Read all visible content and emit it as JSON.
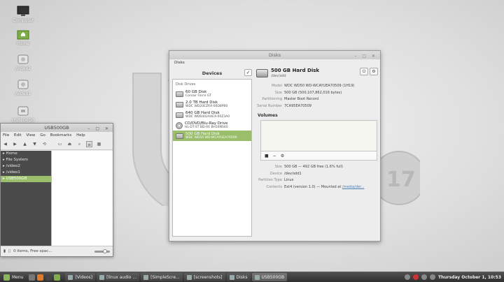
{
  "desktop": {
    "icons": [
      {
        "label": "Computer",
        "icon": "computer-icon"
      },
      {
        "label": "Home",
        "icon": "home-folder-icon"
      },
      {
        "label": "/video2",
        "icon": "drive-icon"
      },
      {
        "label": "/video1",
        "icon": "drive-icon"
      },
      {
        "label": "USB500GB",
        "icon": "usb-drive-icon"
      }
    ]
  },
  "file_manager": {
    "title": "USB500GB",
    "menu": [
      "File",
      "Edit",
      "View",
      "Go",
      "Bookmarks",
      "Help"
    ],
    "places": [
      "Home",
      "File System",
      "/video2",
      "/video1",
      "USB500GB"
    ],
    "selected_place": "USB500GB",
    "status": "0 items, Free spac..."
  },
  "disks": {
    "title": "Disks",
    "menu_label": "Disks",
    "devices_header": "Devices",
    "category": "Disk Drives",
    "drives": [
      {
        "name": "60 GB Disk",
        "sub": "Corsair Force GT"
      },
      {
        "name": "2.0 TB Hard Disk",
        "sub": "WDC WD20EZRX-00D8PB0"
      },
      {
        "name": "640 GB Hard Disk",
        "sub": "WDC WD6402AAEX-00Z3A0"
      },
      {
        "name": "CD/DVD/Blu-Ray Drive",
        "sub": "HL-DT-ST BD-RE  BH16NS40"
      },
      {
        "name": "500 GB Hard Disk",
        "sub": "WDC WD50 WD-WCAYUEA70509"
      }
    ],
    "selected_index": 4,
    "header_title": "500 GB Hard Disk",
    "header_sub": "/dev/sdd",
    "details": [
      {
        "k": "Model",
        "v": "WDC WD50 WD-WCAYUEA70509 (1H19)"
      },
      {
        "k": "Size",
        "v": "500 GB (500,107,862,016 bytes)"
      },
      {
        "k": "Partitioning",
        "v": "Master Boot Record"
      },
      {
        "k": "Serial Number",
        "v": "7CA95EA70509"
      }
    ],
    "volumes_label": "Volumes",
    "volume_tools": [
      "■",
      "−",
      "⚙"
    ],
    "volume_info": [
      {
        "k": "Size",
        "v": "500 GB — 492 GB free (1.6% full)"
      },
      {
        "k": "Device",
        "v": "/dev/sdd1"
      },
      {
        "k": "Partition Type",
        "v": "Linux"
      },
      {
        "k": "Contents",
        "v": "Ext4 (version 1.0) — Mounted at ",
        "link": "/media/der..."
      }
    ]
  },
  "taskbar": {
    "menu_label": "Menu",
    "tasks": [
      "[Videos]",
      "[linux audio ...",
      "[SimpleScre...",
      "[screenshots]",
      "Disks",
      "USB500GB"
    ],
    "active_task": "USB500GB",
    "clock": "Thursday October  1, 10:53"
  },
  "colors": {
    "accent": "#9abe6c",
    "panel": "#3a3a3a"
  }
}
